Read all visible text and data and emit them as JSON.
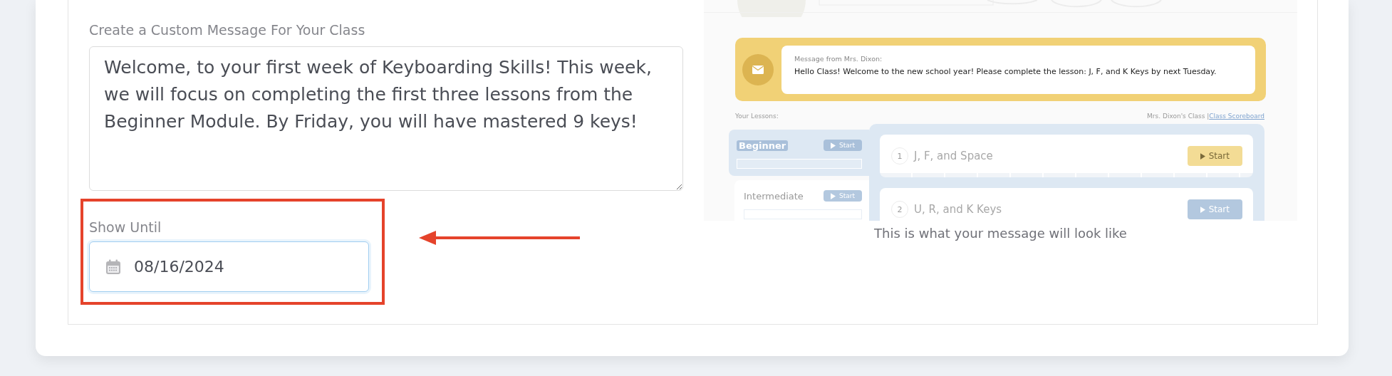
{
  "editor": {
    "label": "Create a Custom Message For Your Class",
    "message": "Welcome, to your first week of Keyboarding Skills! This week, we will focus on completing the first three lessons from the Beginner Module. By Friday, you will have mastered 9 keys!"
  },
  "show_until": {
    "label": "Show Until",
    "value": "08/16/2024"
  },
  "preview": {
    "banner": {
      "from": "Message from Mrs. Dixon:",
      "text": "Hello Class! Welcome to the new school year! Please complete the lesson: J, F, and K Keys by next Tuesday."
    },
    "lessons_label": "Your Lessons:",
    "class_name": "Mrs. Dixon's Class |",
    "scoreboard_link": "Class Scoreboard",
    "modules": [
      {
        "name": "Beginner",
        "button": "Start",
        "selected": true
      },
      {
        "name": "Intermediate",
        "button": "Start",
        "selected": false
      }
    ],
    "lessons": [
      {
        "number": "1",
        "title": "J, F, and Space",
        "button": "Start",
        "current": true
      },
      {
        "number": "2",
        "title": "U, R, and K Keys",
        "button": "Start",
        "current": false
      }
    ]
  },
  "caption": "This is what your message will look like"
}
